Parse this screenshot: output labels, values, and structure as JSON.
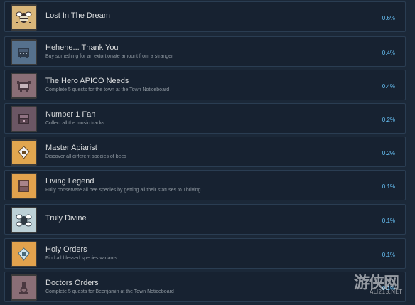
{
  "achievements": [
    {
      "title": "Lost In The Dream",
      "description": "",
      "percent": "0.6%",
      "icon": "bee-icon",
      "bg": "#d9b67a"
    },
    {
      "title": "Hehehe... Thank You",
      "description": "Buy something for an extortionate amount from a stranger",
      "percent": "0.4%",
      "icon": "chest-icon",
      "bg": "#56718d"
    },
    {
      "title": "The Hero APICO Needs",
      "description": "Complete 5 quests for the town at the Town Noticeboard",
      "percent": "0.4%",
      "icon": "crown-icon",
      "bg": "#8a6e76"
    },
    {
      "title": "Number 1 Fan",
      "description": "Collect all the music tracks",
      "percent": "0.2%",
      "icon": "jukebox-icon",
      "bg": "#6b5664"
    },
    {
      "title": "Master Apiarist",
      "description": "Discover all different species of bees",
      "percent": "0.2%",
      "icon": "bee-badge-icon",
      "bg": "#e1a64f"
    },
    {
      "title": "Living Legend",
      "description": "Fully conservate all bee species by getting all their statuses to Thriving",
      "percent": "0.1%",
      "icon": "statue-icon",
      "bg": "#e2a24d"
    },
    {
      "title": "Truly Divine",
      "description": "",
      "percent": "0.1%",
      "icon": "divine-bee-icon",
      "bg": "#bcd0d6"
    },
    {
      "title": "Holy Orders",
      "description": "Find all blessed species variants",
      "percent": "0.1%",
      "icon": "holy-bee-icon",
      "bg": "#e2a24d"
    },
    {
      "title": "Doctors Orders",
      "description": "Complete 5 quests for Beenjamin at the Town Noticeboard",
      "percent": "0.1%",
      "icon": "microscope-icon",
      "bg": "#8a6e76"
    }
  ],
  "watermark": {
    "text": "游侠网",
    "sub": "ALI213.NET"
  }
}
